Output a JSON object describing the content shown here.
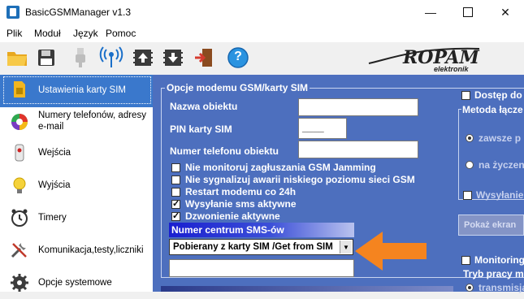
{
  "window": {
    "title": "BasicGSMManager v1.3",
    "minimize": "—",
    "close": "✕"
  },
  "menu": [
    "Plik",
    "Moduł",
    "Język",
    "Pomoc"
  ],
  "toolbar": {
    "icons": [
      "folder-open-icon",
      "save-floppy-icon",
      "usb-plug-icon",
      "antenna-signal-icon",
      "chip-upload-icon",
      "chip-download-icon",
      "exit-door-icon",
      "help-icon"
    ],
    "help_glyph": "?"
  },
  "logo": {
    "brand": "ROPAM",
    "sub": "elektronik"
  },
  "nav": [
    {
      "label": "Ustawienia karty SIM",
      "icon": "sim-card-icon",
      "active": true
    },
    {
      "label": "Numery telefonów, adresy e-mail",
      "icon": "contacts-pie-icon",
      "active": false
    },
    {
      "label": "Wejścia",
      "icon": "sensor-input-icon",
      "active": false
    },
    {
      "label": "Wyjścia",
      "icon": "lightbulb-output-icon",
      "active": false
    },
    {
      "label": "Timery",
      "icon": "alarm-clock-icon",
      "active": false
    },
    {
      "label": "Komunikacja,testy,liczniki",
      "icon": "tools-icon",
      "active": false
    },
    {
      "label": "Opcje systemowe",
      "icon": "gear-icon",
      "active": false
    }
  ],
  "modem_group": {
    "title": "Opcje modemu GSM/karty SIM",
    "fields": {
      "object_name": {
        "label": "Nazwa obiektu",
        "value": ""
      },
      "pin": {
        "label": "PIN karty SIM",
        "value": "____"
      },
      "phone": {
        "label": "Numer telefonu obiektu",
        "value": ""
      }
    },
    "checkboxes": [
      {
        "label": "Nie monitoruj zagłuszania GSM Jamming",
        "checked": false
      },
      {
        "label": "Nie sygnalizuj awarii niskiego poziomu sieci GSM",
        "checked": false
      },
      {
        "label": "Restart modemu co 24h",
        "checked": false
      },
      {
        "label": "Wysyłanie sms aktywne",
        "checked": true
      },
      {
        "label": "Dzwonienie aktywne",
        "checked": true
      }
    ],
    "sms_center": {
      "header": "Numer centrum SMS-ów",
      "selected": "Pobierany z karty SIM /Get from SIM",
      "manual_value": ""
    }
  },
  "right_group": {
    "remote_access": "Dostęp do",
    "method": "Metoda łącze",
    "option_always": "zawsze p",
    "option_on_request": "na życzen",
    "sending": "Wysyłanie",
    "show_button": "Pokaż ekran",
    "monitoring": "Monitoring",
    "mode": "Tryb pracy m",
    "mode_option": "transmisja"
  },
  "colors": {
    "panel": "#4d6fbe",
    "nav_active": "#3a78cc",
    "arrow": "#f5841f"
  }
}
